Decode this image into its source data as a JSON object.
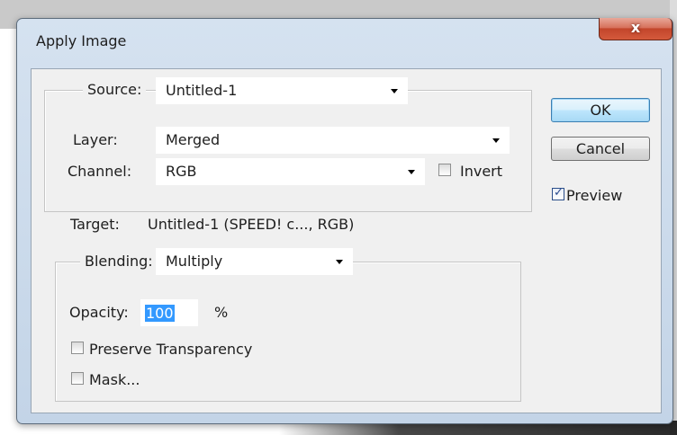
{
  "dialog": {
    "title": "Apply Image",
    "close_glyph": "x"
  },
  "source_group": {
    "source_label": "Source:",
    "source_value": "Untitled-1",
    "layer_label": "Layer:",
    "layer_value": "Merged",
    "channel_label": "Channel:",
    "channel_value": "RGB",
    "invert_label": "Invert",
    "invert_checked": false
  },
  "target": {
    "label": "Target:",
    "value": "Untitled-1 (SPEED! c..., RGB)"
  },
  "blending_group": {
    "blending_label": "Blending:",
    "blending_value": "Multiply",
    "opacity_label": "Opacity:",
    "opacity_value": "100",
    "opacity_unit": "%",
    "preserve_transparency_label": "Preserve Transparency",
    "preserve_transparency_checked": false,
    "mask_label": "Mask...",
    "mask_checked": false
  },
  "buttons": {
    "ok_label": "OK",
    "cancel_label": "Cancel",
    "preview_label": "Preview",
    "preview_checked": true
  },
  "icons": {
    "dropdown_arrow": "chevron-down-icon",
    "checkmark": "checkmark-icon",
    "close": "close-icon"
  }
}
